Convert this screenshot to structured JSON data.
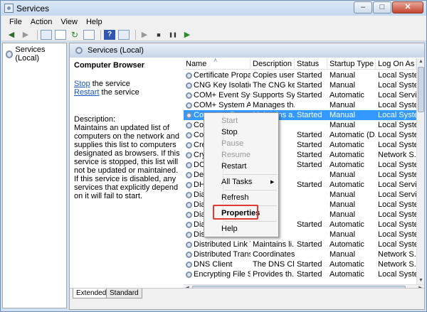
{
  "window": {
    "title": "Services",
    "minimize": "–",
    "maximize": "□",
    "close": "✕"
  },
  "menubar": [
    "File",
    "Action",
    "View",
    "Help"
  ],
  "toolbar": {
    "back": "◀",
    "forward": "▶",
    "play": "▶",
    "stop": "■",
    "pause": "❚❚",
    "restart": "▶",
    "help": "?"
  },
  "tree": {
    "root": "Services (Local)"
  },
  "pane_header": "Services (Local)",
  "details": {
    "title": "Computer Browser",
    "stop_link": "Stop",
    "stop_suffix": " the service",
    "restart_link": "Restart",
    "restart_suffix": " the service",
    "description_label": "Description:",
    "description": "Maintains an updated list of computers on the network and supplies this list to computers designated as browsers. If this service is stopped, this list will not be updated or maintained. If this service is disabled, any services that explicitly depend on it will fail to start."
  },
  "columns": [
    "Name",
    "Description",
    "Status",
    "Startup Type",
    "Log On As"
  ],
  "rows": [
    {
      "name": "Certificate Propaga...",
      "description": "Copies user ...",
      "status": "Started",
      "startup": "Manual",
      "logon": "Local Syste..."
    },
    {
      "name": "CNG Key Isolation",
      "description": "The CNG key ...",
      "status": "Started",
      "startup": "Manual",
      "logon": "Local Syste..."
    },
    {
      "name": "COM+ Event System",
      "description": "Supports Sy...",
      "status": "Started",
      "startup": "Automatic",
      "logon": "Local Service"
    },
    {
      "name": "COM+ System Ap...",
      "description": "Manages th...",
      "status": "",
      "startup": "Manual",
      "logon": "Local Syste..."
    },
    {
      "name": "Computer Browser",
      "description": "Maintains a...",
      "status": "Started",
      "startup": "Manual",
      "logon": "Local Syste...",
      "selected": true
    },
    {
      "name": "Co",
      "description": "",
      "status": "",
      "startup": "Manual",
      "logon": "Local Syste..."
    },
    {
      "name": "Co",
      "description": "",
      "status": "Started",
      "startup": "Automatic (D...",
      "logon": "Local Syste..."
    },
    {
      "name": "Cre",
      "description": "",
      "status": "Started",
      "startup": "Automatic",
      "logon": "Local Syste..."
    },
    {
      "name": "Cry",
      "description": "",
      "status": "Started",
      "startup": "Automatic",
      "logon": "Network S..."
    },
    {
      "name": "DC",
      "description": "",
      "status": "Started",
      "startup": "Automatic",
      "logon": "Local Syste..."
    },
    {
      "name": "Des",
      "description": "",
      "status": "",
      "startup": "Manual",
      "logon": "Local Syste..."
    },
    {
      "name": "DH",
      "description": "",
      "status": "Started",
      "startup": "Automatic",
      "logon": "Local Service"
    },
    {
      "name": "Dia",
      "description": "",
      "status": "",
      "startup": "Manual",
      "logon": "Local Service"
    },
    {
      "name": "Dia",
      "description": "",
      "status": "",
      "startup": "Manual",
      "logon": "Local Syste..."
    },
    {
      "name": "Dia",
      "description": "",
      "status": "",
      "startup": "Manual",
      "logon": "Local Syste..."
    },
    {
      "name": "Dia",
      "description": "",
      "status": "Started",
      "startup": "Automatic",
      "logon": "Local Syste..."
    },
    {
      "name": "Dis",
      "description": "",
      "status": "",
      "startup": "Manual",
      "logon": "Local Syste..."
    },
    {
      "name": "Distributed Link Tr...",
      "description": "Maintains li...",
      "status": "Started",
      "startup": "Automatic",
      "logon": "Local Syste..."
    },
    {
      "name": "Distributed Transa...",
      "description": "Coordinates...",
      "status": "",
      "startup": "Manual",
      "logon": "Network S..."
    },
    {
      "name": "DNS Client",
      "description": "The DNS Cli...",
      "status": "Started",
      "startup": "Automatic",
      "logon": "Network S..."
    },
    {
      "name": "Encrypting File Sy...",
      "description": "Provides th...",
      "status": "Started",
      "startup": "Automatic",
      "logon": "Local Syste..."
    }
  ],
  "context_menu": {
    "start": "Start",
    "stop": "Stop",
    "pause": "Pause",
    "resume": "Resume",
    "restart": "Restart",
    "all_tasks": "All Tasks",
    "refresh": "Refresh",
    "properties": "Properties",
    "help": "Help"
  },
  "tabs": {
    "extended": "Extended",
    "standard": "Standard"
  },
  "colors": {
    "selection": "#3399ff",
    "highlight_box": "#e03a35",
    "link": "#1a55c6"
  }
}
